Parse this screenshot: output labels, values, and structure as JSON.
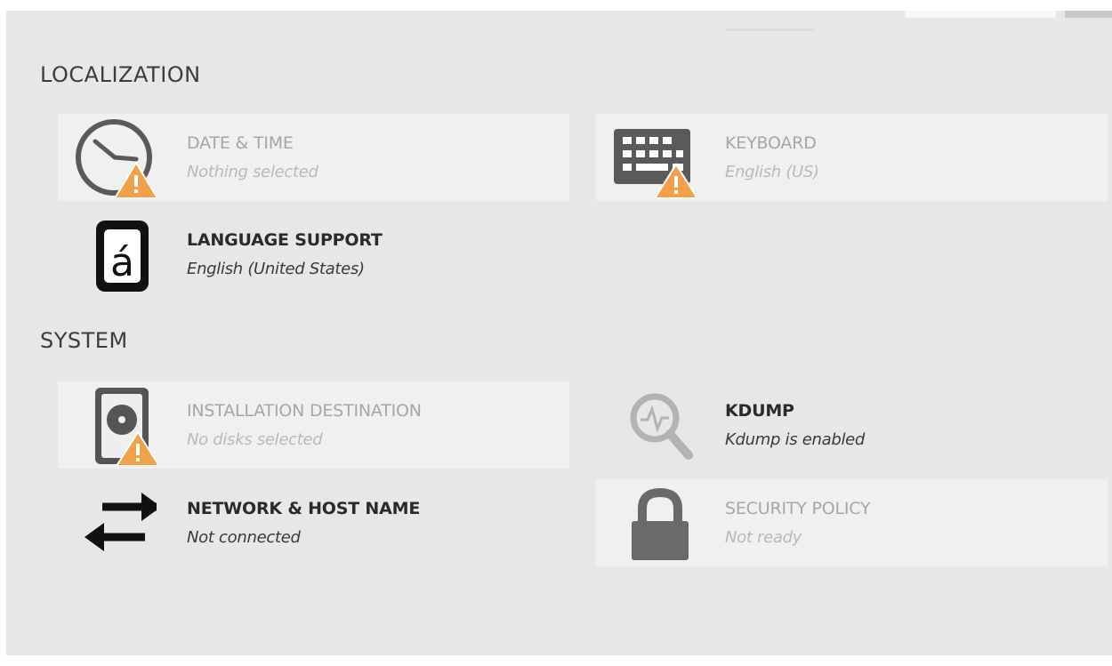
{
  "sections": {
    "localization": {
      "title": "LOCALIZATION",
      "date_time": {
        "name": "DATE & TIME",
        "status": "Nothing selected",
        "icon": "clock-icon",
        "warning": true
      },
      "keyboard": {
        "name": "KEYBOARD",
        "status": "English (US)",
        "icon": "keyboard-icon",
        "warning": true
      },
      "language_support": {
        "name": "LANGUAGE SUPPORT",
        "status": "English (United States)",
        "icon": "language-icon",
        "glyph": "á"
      }
    },
    "system": {
      "title": "SYSTEM",
      "installation_destination": {
        "name": "INSTALLATION DESTINATION",
        "status": "No disks selected",
        "icon": "disk-icon",
        "warning": true
      },
      "kdump": {
        "name": "KDUMP",
        "status": "Kdump is enabled",
        "icon": "magnifier-icon"
      },
      "network": {
        "name": "NETWORK & HOST NAME",
        "status": "Not connected",
        "icon": "network-arrows-icon"
      },
      "security_policy": {
        "name": "SECURITY POLICY",
        "status": "Not ready",
        "icon": "lock-icon"
      }
    }
  },
  "colors": {
    "panel_background": "#e8e6e8",
    "incomplete_tile": "#f1f0f1",
    "warning": "#f0a14a",
    "heading_text": "#3c3c3c",
    "muted_text": "#a6a5a7"
  }
}
